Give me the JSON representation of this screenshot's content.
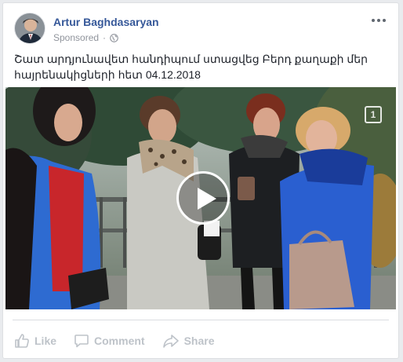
{
  "post": {
    "author": "Artur Baghdasaryan",
    "sponsored_label": "Sponsored",
    "separator": "·",
    "privacy_icon": "globe-icon",
    "more_icon": "more-options-icon",
    "caption": "Շատ արդյունավետ հանդիպում ստացվեց Բերդ քաղաքի մեր հայրենակիցների հետ 04.12.2018"
  },
  "video": {
    "channel_logo": "1",
    "play_icon": "play-icon"
  },
  "actions": [
    {
      "label": "Like",
      "icon": "thumbs-up-icon"
    },
    {
      "label": "Comment",
      "icon": "comment-icon"
    },
    {
      "label": "Share",
      "icon": "share-icon"
    }
  ],
  "colors": {
    "author_link": "#365899",
    "meta_text": "#90949c",
    "action_text": "#bec3c9"
  }
}
